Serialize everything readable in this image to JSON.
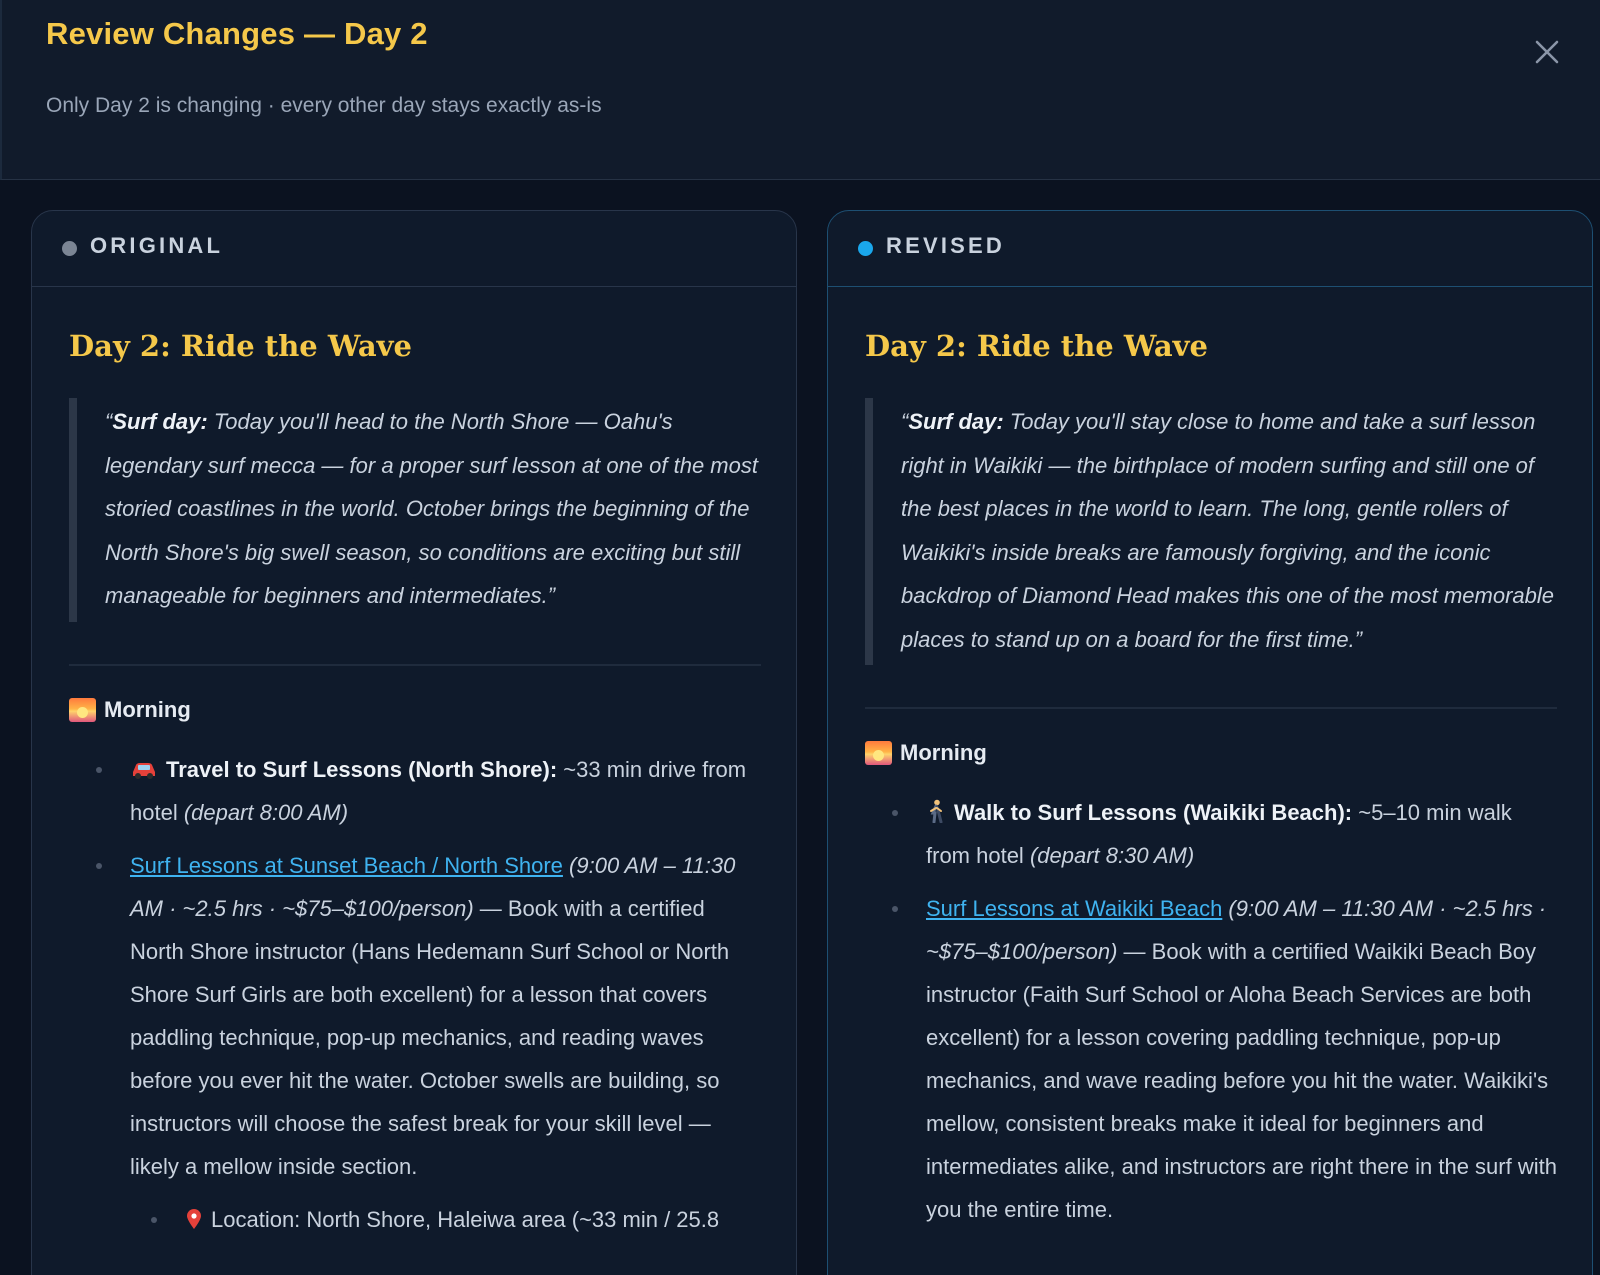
{
  "header": {
    "title": "Review Changes — Day 2",
    "subtitle": "Only Day 2 is changing · every other day stays exactly as-is"
  },
  "colors": {
    "accent": "#f5c84a",
    "link": "#3fb3f0",
    "original_dot": "#7b8594",
    "revised_dot": "#1aa7ec"
  },
  "original": {
    "label": "ORIGINAL",
    "day_title": "Day 2: Ride the Wave",
    "quote_open": "“",
    "quote_lead": "Surf day:",
    "quote_text": " Today you'll head to the North Shore — Oahu's legendary surf mecca — for a proper surf lesson at one of the most storied coastlines in the world. October brings the beginning of the North Shore's big swell season, so conditions are exciting but still manageable for beginners and intermediates.”",
    "section": "Morning",
    "travel_title": "Travel to Surf Lessons (North Shore):",
    "travel_text": " ~33 min drive from hotel ",
    "travel_depart": "(depart 8:00 AM)",
    "lesson_link": "Surf Lessons at Sunset Beach / North Shore",
    "lesson_meta": " (9:00 AM – 11:30 AM · ~2.5 hrs · ~$75–$100/person)",
    "lesson_text": " — Book with a certified North Shore instructor (Hans Hedemann Surf School or North Shore Surf Girls are both excellent) for a lesson that covers paddling technique, pop-up mechanics, and reading waves before you ever hit the water. October swells are building, so instructors will choose the safest break for your skill level — likely a mellow inside section.",
    "location_text": "Location: North Shore, Haleiwa area (~33 min / 25.8"
  },
  "revised": {
    "label": "REVISED",
    "day_title": "Day 2: Ride the Wave",
    "quote_open": "“",
    "quote_lead": "Surf day:",
    "quote_text": " Today you'll stay close to home and take a surf lesson right in Waikiki — the birthplace of modern surfing and still one of the best places in the world to learn. The long, gentle rollers of Waikiki's inside breaks are famously forgiving, and the iconic backdrop of Diamond Head makes this one of the most memorable places to stand up on a board for the first time.”",
    "section": "Morning",
    "travel_title": "Walk to Surf Lessons (Waikiki Beach):",
    "travel_text": " ~5–10 min walk from hotel ",
    "travel_depart": "(depart 8:30 AM)",
    "lesson_link": "Surf Lessons at Waikiki Beach",
    "lesson_meta": " (9:00 AM – 11:30 AM · ~2.5 hrs · ~$75–$100/person)",
    "lesson_text": " — Book with a certified Waikiki Beach Boy instructor (Faith Surf School or Aloha Beach Services are both excellent) for a lesson covering paddling technique, pop-up mechanics, and wave reading before you hit the water. Waikiki's mellow, consistent breaks make it ideal for beginners and intermediates alike, and instructors are right there in the surf with you the entire time."
  }
}
